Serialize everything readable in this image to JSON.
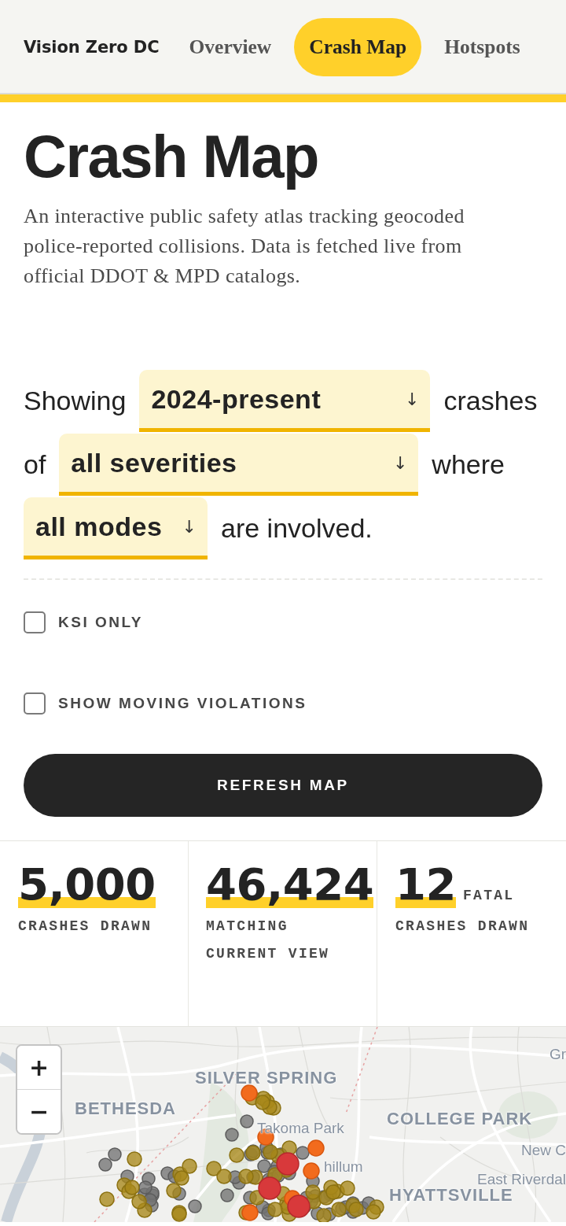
{
  "header": {
    "logo": "Vision Zero DC",
    "nav": [
      {
        "label": "Overview",
        "selected": false
      },
      {
        "label": "Crash Map",
        "selected": true
      },
      {
        "label": "Hotspots",
        "selected": false
      }
    ]
  },
  "page": {
    "title": "Crash Map",
    "description": "An interactive public safety atlas tracking geocoded police-reported collisions. Data is fetched live from official DDOT & MPD catalogs."
  },
  "filter_sentence": [
    {
      "kind": "text",
      "text": "Showing"
    },
    {
      "kind": "select",
      "value": "2024-present",
      "arrow": "↓"
    },
    {
      "kind": "text",
      "text": "crashes"
    },
    {
      "kind": "text",
      "text": "of"
    },
    {
      "kind": "select",
      "value": "all severities",
      "arrow": "↓"
    },
    {
      "kind": "text",
      "text": "where"
    },
    {
      "kind": "select",
      "value": "all modes",
      "arrow": "↓"
    },
    {
      "kind": "text",
      "text": "are involved."
    }
  ],
  "options": [
    {
      "label": "KSI ONLY",
      "checked": false
    },
    {
      "label": "SHOW MOVING VIOLATIONS",
      "checked": false
    }
  ],
  "refresh_button": "REFRESH MAP",
  "stats": [
    {
      "value": "5,000",
      "label": "CRASHES DRAWN"
    },
    {
      "value": "46,424",
      "label": "MATCHING CURRENT VIEW"
    },
    {
      "value": "12",
      "unit": "FATAL",
      "label": "CRASHES DRAWN"
    }
  ],
  "map": {
    "zoom_in": "+",
    "zoom_out": "−",
    "place_labels": [
      {
        "text": "Gr",
        "kind": "town"
      },
      {
        "text": "SILVER SPRING",
        "kind": "city"
      },
      {
        "text": "BETHESDA",
        "kind": "city"
      },
      {
        "text": "COLLEGE PARK",
        "kind": "city"
      },
      {
        "text": "Takoma Park",
        "kind": "town"
      },
      {
        "text": "New C",
        "kind": "town"
      },
      {
        "text": "hillum",
        "kind": "town"
      },
      {
        "text": "East Riverdal",
        "kind": "town"
      },
      {
        "text": "HYATTSVILLE",
        "kind": "city"
      }
    ]
  }
}
